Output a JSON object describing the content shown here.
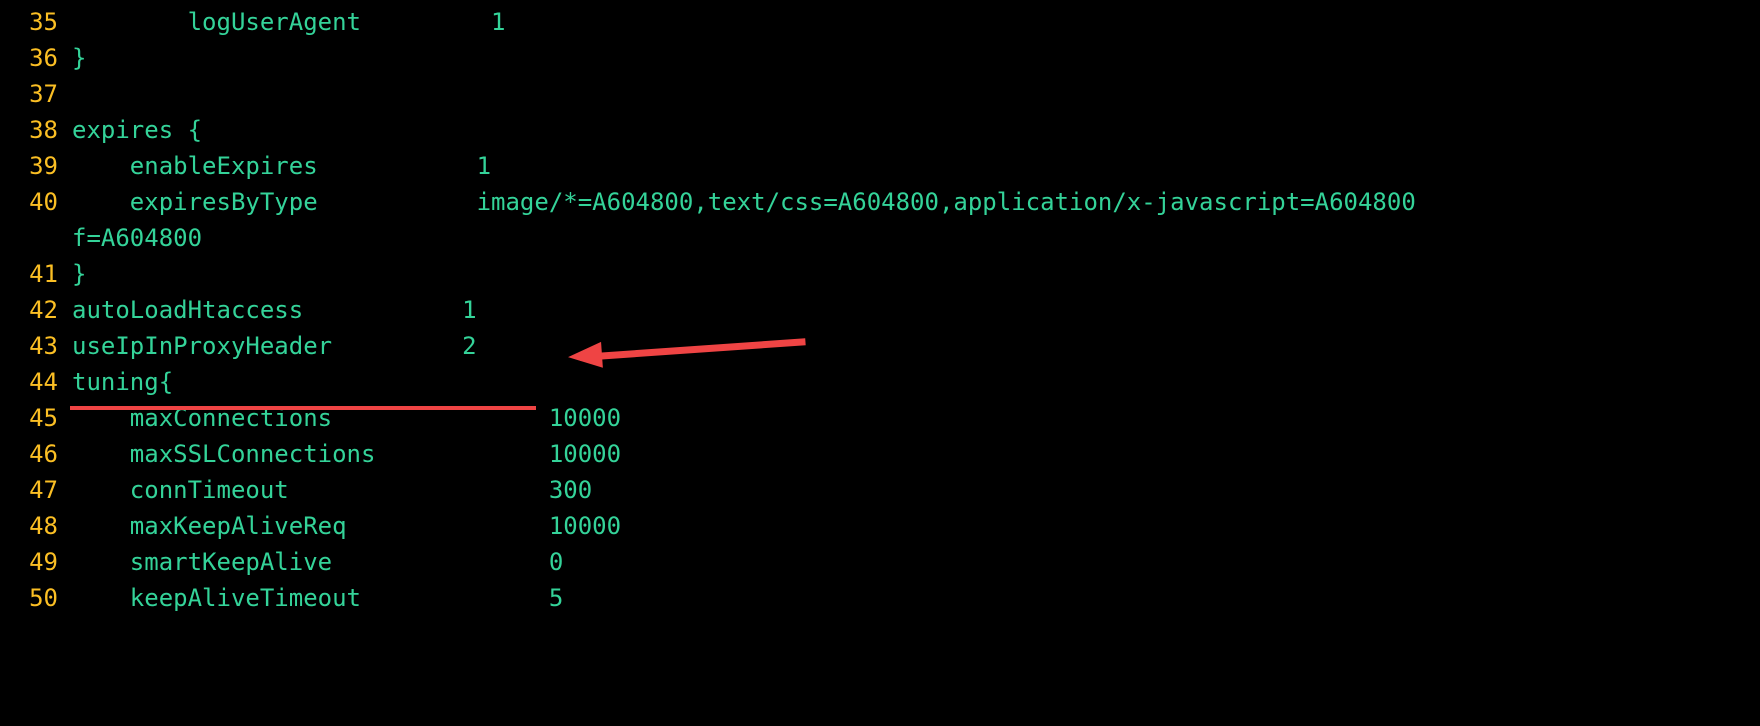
{
  "lines": [
    {
      "num": "35",
      "indent": "        ",
      "text": "logUserAgent         1"
    },
    {
      "num": "36",
      "indent": "",
      "text": "}"
    },
    {
      "num": "37",
      "indent": "",
      "text": ""
    },
    {
      "num": "38",
      "indent": "",
      "text": "expires {"
    },
    {
      "num": "39",
      "indent": "    ",
      "text": "enableExpires           1"
    },
    {
      "num": "40",
      "indent": "    ",
      "text": "expiresByType           image/*=A604800,text/css=A604800,application/x-javascript=A604800"
    },
    {
      "num": "",
      "indent": "",
      "text": "f=A604800",
      "wrap": true
    },
    {
      "num": "41",
      "indent": "",
      "text": "}"
    },
    {
      "num": "42",
      "indent": "",
      "text": "autoLoadHtaccess           1"
    },
    {
      "num": "43",
      "indent": "",
      "text": "useIpInProxyHeader         2"
    },
    {
      "num": "44",
      "indent": "",
      "text": "tuning{"
    },
    {
      "num": "45",
      "indent": "    ",
      "text": "maxConnections               10000"
    },
    {
      "num": "46",
      "indent": "    ",
      "text": "maxSSLConnections            10000"
    },
    {
      "num": "47",
      "indent": "    ",
      "text": "connTimeout                  300"
    },
    {
      "num": "48",
      "indent": "    ",
      "text": "maxKeepAliveReq              10000"
    },
    {
      "num": "49",
      "indent": "    ",
      "text": "smartKeepAlive               0"
    },
    {
      "num": "50",
      "indent": "    ",
      "text": "keepAliveTimeout             5"
    }
  ],
  "annotation": {
    "target_line": 43,
    "description": "red underline under useIpInProxyHeader 2 with red arrow pointing to it"
  }
}
